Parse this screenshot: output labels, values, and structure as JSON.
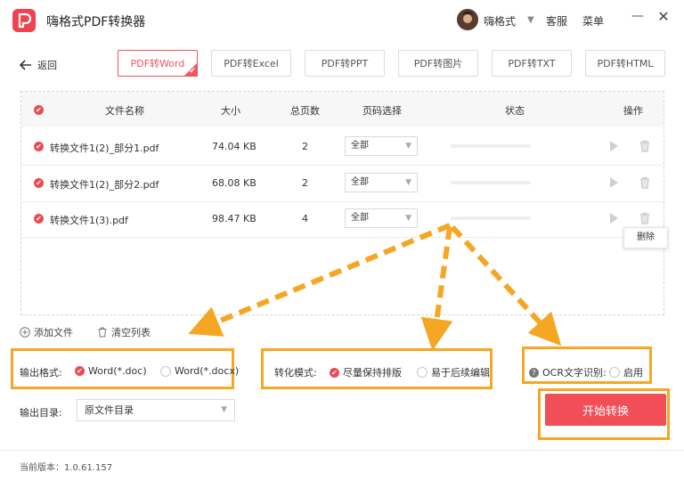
{
  "app": {
    "title": "嗨格式PDF转换器",
    "username": "嗨格式",
    "service": "客服",
    "menu": "菜单"
  },
  "nav": {
    "back": "返回"
  },
  "tabs": [
    {
      "label": "PDF转Word",
      "active": true
    },
    {
      "label": "PDF转Excel",
      "active": false
    },
    {
      "label": "PDF转PPT",
      "active": false
    },
    {
      "label": "PDF转图片",
      "active": false
    },
    {
      "label": "PDF转TXT",
      "active": false
    },
    {
      "label": "PDF转HTML",
      "active": false
    }
  ],
  "table": {
    "headers": {
      "name": "文件名称",
      "size": "大小",
      "pages": "总页数",
      "range": "页码选择",
      "status": "状态",
      "ops": "操作"
    },
    "rows": [
      {
        "name": "转换文件1(2)_部分1.pdf",
        "size": "74.04 KB",
        "pages": "2",
        "range": "全部"
      },
      {
        "name": "转换文件1(2)_部分2.pdf",
        "size": "68.08 KB",
        "pages": "2",
        "range": "全部"
      },
      {
        "name": "转换文件1(3).pdf",
        "size": "98.47 KB",
        "pages": "4",
        "range": "全部"
      }
    ],
    "delete_tip": "删除"
  },
  "actions": {
    "add_file": "添加文件",
    "clear_list": "清空列表"
  },
  "output_format": {
    "label": "输出格式:",
    "options": [
      {
        "label": "Word(*.doc)",
        "selected": true
      },
      {
        "label": "Word(*.docx)",
        "selected": false
      }
    ]
  },
  "convert_mode": {
    "label": "转化模式:",
    "options": [
      {
        "label": "尽量保持排版",
        "selected": true
      },
      {
        "label": "易于后续编辑",
        "selected": false
      }
    ]
  },
  "ocr": {
    "label": "OCR文字识别:",
    "option": "启用",
    "enabled": false
  },
  "output_dir": {
    "label": "输出目录:",
    "value": "原文件目录"
  },
  "start_button": "开始转换",
  "version": "当前版本：1.0.61.157",
  "colors": {
    "accent": "#f24e58",
    "highlight": "#f5a623"
  }
}
